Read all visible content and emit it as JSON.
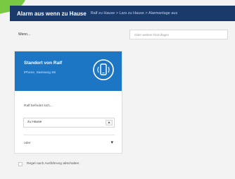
{
  "header": {
    "title": "Alarm aus wenn zu Hause",
    "breadcrumb": "Ralf zu Hause > Lars zu Hause > Alarmanlage aus"
  },
  "field": {
    "label": "Wenn...",
    "select_placeholder": "Oder weitere hinzufügen"
  },
  "card": {
    "title": "Standort von Ralf",
    "subtitle": "iPhone, Samsung S6",
    "icon": "phone-location-icon",
    "question": "Ralf befindet sich...",
    "select_value": "zu Hause",
    "select_button": "▲",
    "footer_text": "oder",
    "footer_icon": "chevron-down-icon",
    "footer_symbol": "▾"
  },
  "options": {
    "checkbox_label": "Regel nach Ausführung abschalten"
  },
  "colors": {
    "header_bg": "#1a3a6b",
    "card_accent": "#1c76c4",
    "corner_accent": "#7ac943"
  }
}
